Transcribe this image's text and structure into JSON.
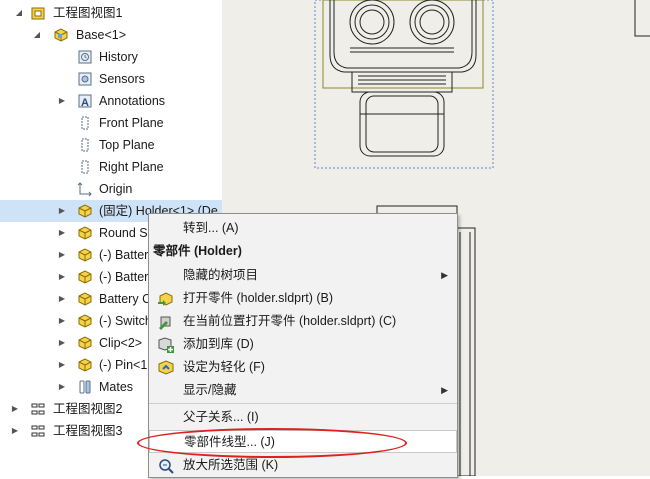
{
  "tree": {
    "drawing_view1": "工程图视图1",
    "base": "Base<1>",
    "history": "History",
    "sensors": "Sensors",
    "annotations": "Annotations",
    "front_plane": "Front Plane",
    "top_plane": "Top Plane",
    "right_plane": "Right Plane",
    "origin": "Origin",
    "holder": "(固定) Holder<1> (De",
    "round": "Round S",
    "batter1": "(-) Batter",
    "batter2": "(-) Batter",
    "battery": "Battery C",
    "switch": "(-) Switch",
    "clip": "Clip<2>",
    "pin": "(-) Pin<1",
    "mates": "Mates",
    "drawing_view2": "工程图视图2",
    "drawing_view3": "工程图视图3"
  },
  "menu": {
    "goto": "转到... (A)",
    "component_header": "零部件 (Holder)",
    "hide_tree_items": "隐藏的树项目",
    "open_part": "打开零件 (holder.sldprt) (B)",
    "open_in_place": "在当前位置打开零件 (holder.sldprt) (C)",
    "add_to_library": "添加到库 (D)",
    "set_lightweight": "设定为轻化 (F)",
    "show_hide": "显示/隐藏",
    "parent_child": "父子关系... (I)",
    "component_line_font": "零部件线型... (J)",
    "zoom_to_selection": "放大所选范围 (K)"
  },
  "colors": {
    "highlight_oval": "#e02020",
    "selection": "#cfe3f8",
    "canvas": "#efeee8"
  }
}
